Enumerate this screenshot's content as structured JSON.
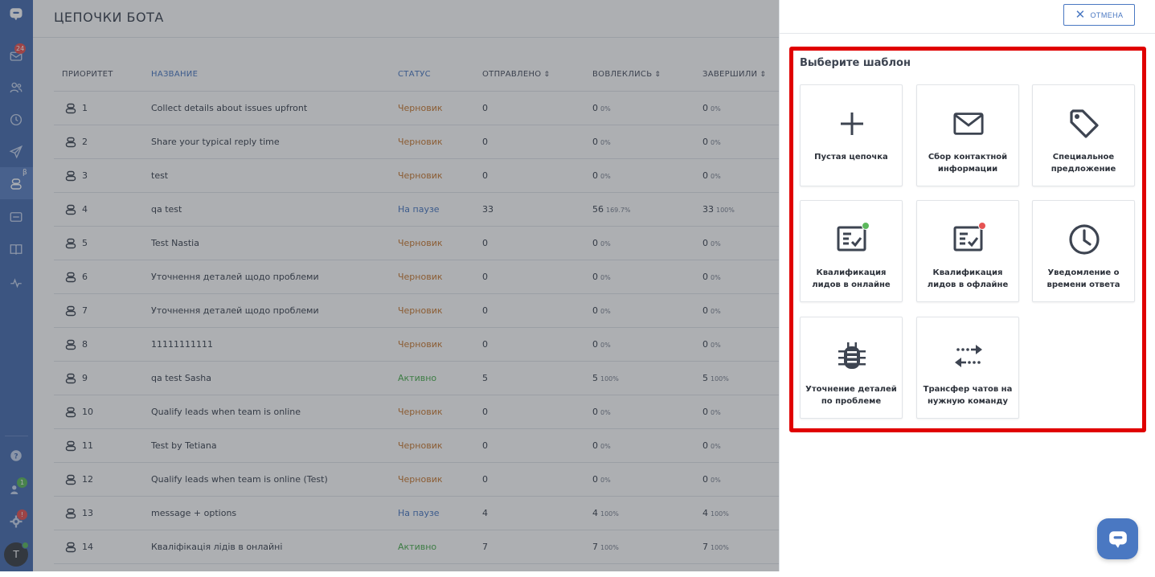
{
  "header": {
    "title": "ЦЕПОЧКИ БОТА"
  },
  "sidebar": {
    "inbox_badge": "24",
    "bot_beta": "β",
    "team_badge": "1",
    "settings_badge": "!",
    "avatar_initial": "T"
  },
  "table": {
    "columns": {
      "priority": "ПРИОРИТЕТ",
      "name": "НАЗВАНИЕ",
      "status": "СТАТУС",
      "sent": "ОТПРАВЛЕНО",
      "engaged": "ВОВЛЕКЛИСЬ",
      "completed": "ЗАВЕРШИЛИ"
    },
    "rows": [
      {
        "priority": "1",
        "name": "Collect details about issues upfront",
        "status": "Черновик",
        "status_type": "draft",
        "sent": "0",
        "engaged": "0",
        "engaged_pct": "0%",
        "completed": "0",
        "completed_pct": "0%"
      },
      {
        "priority": "2",
        "name": "Share your typical reply time",
        "status": "Черновик",
        "status_type": "draft",
        "sent": "0",
        "engaged": "0",
        "engaged_pct": "0%",
        "completed": "0",
        "completed_pct": "0%"
      },
      {
        "priority": "3",
        "name": "test",
        "status": "Черновик",
        "status_type": "draft",
        "sent": "0",
        "engaged": "0",
        "engaged_pct": "0%",
        "completed": "0",
        "completed_pct": "0%"
      },
      {
        "priority": "4",
        "name": "qa test",
        "status": "На паузе",
        "status_type": "paused",
        "sent": "33",
        "engaged": "56",
        "engaged_pct": "169.7%",
        "completed": "33",
        "completed_pct": "100%"
      },
      {
        "priority": "5",
        "name": "Test Nastia",
        "status": "Черновик",
        "status_type": "draft",
        "sent": "0",
        "engaged": "0",
        "engaged_pct": "0%",
        "completed": "0",
        "completed_pct": "0%"
      },
      {
        "priority": "6",
        "name": "Уточнення деталей щодо проблеми",
        "status": "Черновик",
        "status_type": "draft",
        "sent": "0",
        "engaged": "0",
        "engaged_pct": "0%",
        "completed": "0",
        "completed_pct": "0%"
      },
      {
        "priority": "7",
        "name": "Уточнення деталей щодо проблеми",
        "status": "Черновик",
        "status_type": "draft",
        "sent": "0",
        "engaged": "0",
        "engaged_pct": "0%",
        "completed": "0",
        "completed_pct": "0%"
      },
      {
        "priority": "8",
        "name": "11111111111",
        "status": "Черновик",
        "status_type": "draft",
        "sent": "0",
        "engaged": "0",
        "engaged_pct": "0%",
        "completed": "0",
        "completed_pct": "0%"
      },
      {
        "priority": "9",
        "name": "qa test Sasha",
        "status": "Активно",
        "status_type": "active",
        "sent": "5",
        "engaged": "5",
        "engaged_pct": "100%",
        "completed": "5",
        "completed_pct": "100%"
      },
      {
        "priority": "10",
        "name": "Qualify leads when team is online",
        "status": "Черновик",
        "status_type": "draft",
        "sent": "0",
        "engaged": "0",
        "engaged_pct": "0%",
        "completed": "0",
        "completed_pct": "0%"
      },
      {
        "priority": "11",
        "name": "Test by Tetiana",
        "status": "Черновик",
        "status_type": "draft",
        "sent": "0",
        "engaged": "0",
        "engaged_pct": "0%",
        "completed": "0",
        "completed_pct": "0%"
      },
      {
        "priority": "12",
        "name": "Qualify leads when team is online (Test)",
        "status": "Черновик",
        "status_type": "draft",
        "sent": "0",
        "engaged": "0",
        "engaged_pct": "0%",
        "completed": "0",
        "completed_pct": "0%"
      },
      {
        "priority": "13",
        "name": "message + options",
        "status": "На паузе",
        "status_type": "paused",
        "sent": "4",
        "engaged": "4",
        "engaged_pct": "100%",
        "completed": "4",
        "completed_pct": "100%"
      },
      {
        "priority": "14",
        "name": "Кваліфікація лідів в онлайні",
        "status": "Активно",
        "status_type": "active",
        "sent": "7",
        "engaged": "7",
        "engaged_pct": "100%",
        "completed": "7",
        "completed_pct": "100%"
      }
    ]
  },
  "panel": {
    "cancel_label": "ОТМЕНА",
    "title": "Выберите шаблон",
    "templates": [
      {
        "label": "Пустая цепочка",
        "icon": "plus-icon"
      },
      {
        "label": "Сбор контактной информации",
        "icon": "envelope-icon"
      },
      {
        "label": "Специальное предложение",
        "icon": "tag-icon"
      },
      {
        "label": "Квалификация лидов в онлайне",
        "icon": "checklist-online-icon",
        "dot_color": "#5cb85c"
      },
      {
        "label": "Квалификация лидов в офлайне",
        "icon": "checklist-offline-icon",
        "dot_color": "#e55353"
      },
      {
        "label": "Уведомление о времени ответа",
        "icon": "clock-icon"
      },
      {
        "label": "Уточнение деталей по проблеме",
        "icon": "bug-icon"
      },
      {
        "label": "Трансфер чатов на нужную команду",
        "icon": "transfer-arrows-icon"
      }
    ]
  },
  "colors": {
    "accent": "#4a78c2",
    "sidebar": "#4a6fb0",
    "highlight": "#e00000",
    "draft": "#c97a32",
    "paused": "#4a78c2",
    "active": "#4caf50"
  }
}
